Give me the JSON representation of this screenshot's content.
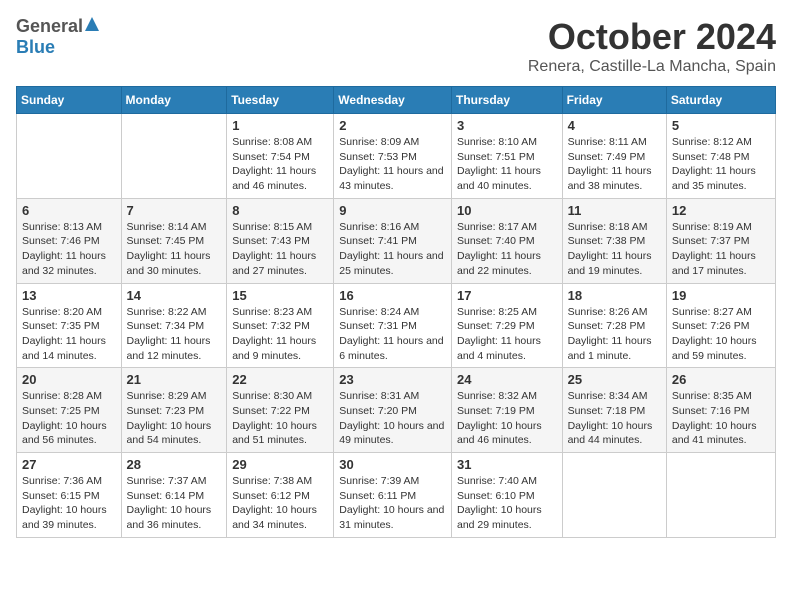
{
  "logo": {
    "general": "General",
    "blue": "Blue"
  },
  "title": "October 2024",
  "subtitle": "Renera, Castille-La Mancha, Spain",
  "days_header": [
    "Sunday",
    "Monday",
    "Tuesday",
    "Wednesday",
    "Thursday",
    "Friday",
    "Saturday"
  ],
  "weeks": [
    [
      {
        "day": "",
        "detail": ""
      },
      {
        "day": "",
        "detail": ""
      },
      {
        "day": "1",
        "detail": "Sunrise: 8:08 AM\nSunset: 7:54 PM\nDaylight: 11 hours and 46 minutes."
      },
      {
        "day": "2",
        "detail": "Sunrise: 8:09 AM\nSunset: 7:53 PM\nDaylight: 11 hours and 43 minutes."
      },
      {
        "day": "3",
        "detail": "Sunrise: 8:10 AM\nSunset: 7:51 PM\nDaylight: 11 hours and 40 minutes."
      },
      {
        "day": "4",
        "detail": "Sunrise: 8:11 AM\nSunset: 7:49 PM\nDaylight: 11 hours and 38 minutes."
      },
      {
        "day": "5",
        "detail": "Sunrise: 8:12 AM\nSunset: 7:48 PM\nDaylight: 11 hours and 35 minutes."
      }
    ],
    [
      {
        "day": "6",
        "detail": "Sunrise: 8:13 AM\nSunset: 7:46 PM\nDaylight: 11 hours and 32 minutes."
      },
      {
        "day": "7",
        "detail": "Sunrise: 8:14 AM\nSunset: 7:45 PM\nDaylight: 11 hours and 30 minutes."
      },
      {
        "day": "8",
        "detail": "Sunrise: 8:15 AM\nSunset: 7:43 PM\nDaylight: 11 hours and 27 minutes."
      },
      {
        "day": "9",
        "detail": "Sunrise: 8:16 AM\nSunset: 7:41 PM\nDaylight: 11 hours and 25 minutes."
      },
      {
        "day": "10",
        "detail": "Sunrise: 8:17 AM\nSunset: 7:40 PM\nDaylight: 11 hours and 22 minutes."
      },
      {
        "day": "11",
        "detail": "Sunrise: 8:18 AM\nSunset: 7:38 PM\nDaylight: 11 hours and 19 minutes."
      },
      {
        "day": "12",
        "detail": "Sunrise: 8:19 AM\nSunset: 7:37 PM\nDaylight: 11 hours and 17 minutes."
      }
    ],
    [
      {
        "day": "13",
        "detail": "Sunrise: 8:20 AM\nSunset: 7:35 PM\nDaylight: 11 hours and 14 minutes."
      },
      {
        "day": "14",
        "detail": "Sunrise: 8:22 AM\nSunset: 7:34 PM\nDaylight: 11 hours and 12 minutes."
      },
      {
        "day": "15",
        "detail": "Sunrise: 8:23 AM\nSunset: 7:32 PM\nDaylight: 11 hours and 9 minutes."
      },
      {
        "day": "16",
        "detail": "Sunrise: 8:24 AM\nSunset: 7:31 PM\nDaylight: 11 hours and 6 minutes."
      },
      {
        "day": "17",
        "detail": "Sunrise: 8:25 AM\nSunset: 7:29 PM\nDaylight: 11 hours and 4 minutes."
      },
      {
        "day": "18",
        "detail": "Sunrise: 8:26 AM\nSunset: 7:28 PM\nDaylight: 11 hours and 1 minute."
      },
      {
        "day": "19",
        "detail": "Sunrise: 8:27 AM\nSunset: 7:26 PM\nDaylight: 10 hours and 59 minutes."
      }
    ],
    [
      {
        "day": "20",
        "detail": "Sunrise: 8:28 AM\nSunset: 7:25 PM\nDaylight: 10 hours and 56 minutes."
      },
      {
        "day": "21",
        "detail": "Sunrise: 8:29 AM\nSunset: 7:23 PM\nDaylight: 10 hours and 54 minutes."
      },
      {
        "day": "22",
        "detail": "Sunrise: 8:30 AM\nSunset: 7:22 PM\nDaylight: 10 hours and 51 minutes."
      },
      {
        "day": "23",
        "detail": "Sunrise: 8:31 AM\nSunset: 7:20 PM\nDaylight: 10 hours and 49 minutes."
      },
      {
        "day": "24",
        "detail": "Sunrise: 8:32 AM\nSunset: 7:19 PM\nDaylight: 10 hours and 46 minutes."
      },
      {
        "day": "25",
        "detail": "Sunrise: 8:34 AM\nSunset: 7:18 PM\nDaylight: 10 hours and 44 minutes."
      },
      {
        "day": "26",
        "detail": "Sunrise: 8:35 AM\nSunset: 7:16 PM\nDaylight: 10 hours and 41 minutes."
      }
    ],
    [
      {
        "day": "27",
        "detail": "Sunrise: 7:36 AM\nSunset: 6:15 PM\nDaylight: 10 hours and 39 minutes."
      },
      {
        "day": "28",
        "detail": "Sunrise: 7:37 AM\nSunset: 6:14 PM\nDaylight: 10 hours and 36 minutes."
      },
      {
        "day": "29",
        "detail": "Sunrise: 7:38 AM\nSunset: 6:12 PM\nDaylight: 10 hours and 34 minutes."
      },
      {
        "day": "30",
        "detail": "Sunrise: 7:39 AM\nSunset: 6:11 PM\nDaylight: 10 hours and 31 minutes."
      },
      {
        "day": "31",
        "detail": "Sunrise: 7:40 AM\nSunset: 6:10 PM\nDaylight: 10 hours and 29 minutes."
      },
      {
        "day": "",
        "detail": ""
      },
      {
        "day": "",
        "detail": ""
      }
    ]
  ]
}
